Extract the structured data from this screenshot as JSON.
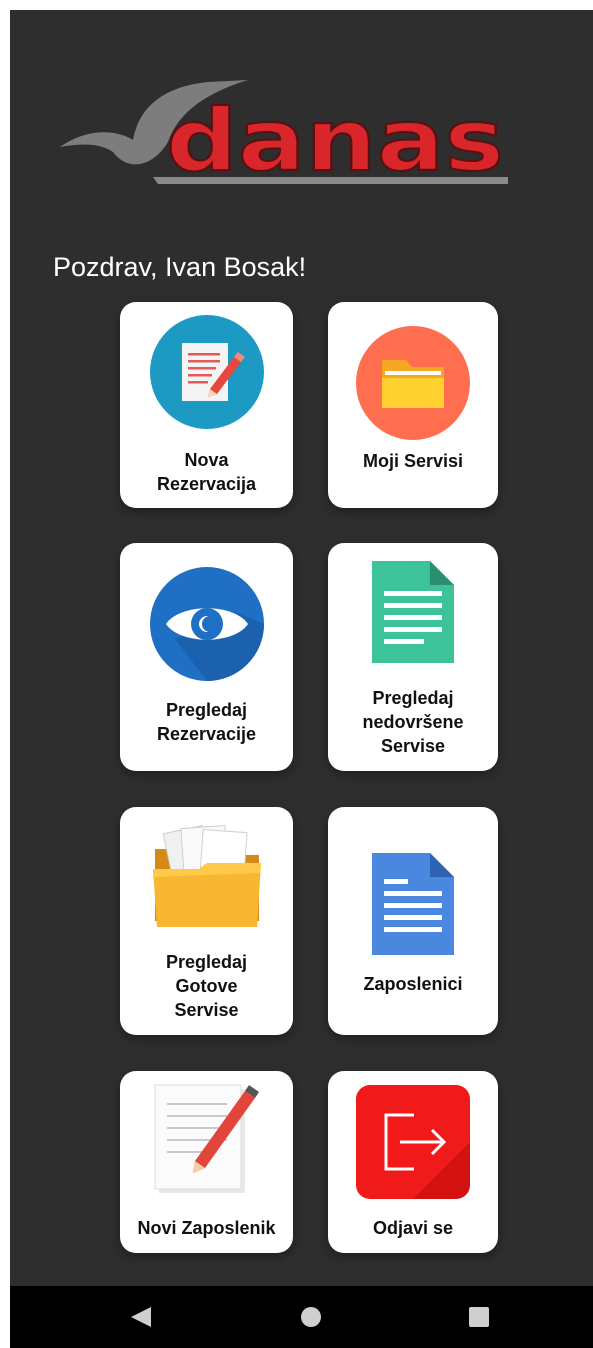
{
  "header": {
    "logo_text": "danas",
    "greeting": "Pozdrav, Ivan Bosak!"
  },
  "tiles": {
    "nova_rezervacija": {
      "label": "Nova\nRezervacija",
      "icon": "document-edit-icon"
    },
    "moji_servisi": {
      "label": "Moji Servisi",
      "icon": "folder-icon"
    },
    "pregledaj_rezervacije": {
      "label": "Pregledaj\nRezervacije",
      "icon": "eye-icon"
    },
    "pregledaj_nedovrsene": {
      "label": "Pregledaj\nnedovršene\nServise",
      "icon": "green-document-icon"
    },
    "pregledaj_gotove": {
      "label": "Pregledaj\nGotove\nServise",
      "icon": "open-folder-icon"
    },
    "zaposlenici": {
      "label": "Zaposlenici",
      "icon": "blue-document-icon"
    },
    "novi_zaposlenik": {
      "label": "Novi Zaposlenik",
      "icon": "pencil-paper-icon"
    },
    "odjavi_se": {
      "label": "Odjavi se",
      "icon": "logout-icon"
    }
  },
  "navbar": {
    "buttons": [
      "back",
      "home",
      "recents"
    ]
  },
  "colors": {
    "background": "#2e2e2e",
    "logo_red": "#d9262a",
    "card": "#ffffff"
  }
}
